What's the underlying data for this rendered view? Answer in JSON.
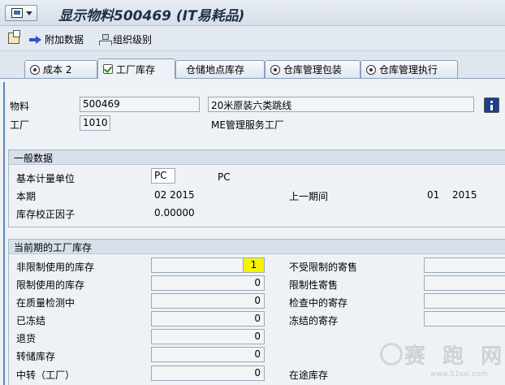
{
  "window": {
    "title": "显示物料500469 (IT易耗品)"
  },
  "toolbar": {
    "additional_data": "附加数据",
    "org_levels": "组织级别"
  },
  "tabs": [
    {
      "label": "成本 2",
      "icon": "radio-icon"
    },
    {
      "label": "工厂库存",
      "icon": "check-icon",
      "active": true
    },
    {
      "label": "仓储地点库存",
      "icon": "none"
    },
    {
      "label": "仓库管理包装",
      "icon": "radio-icon"
    },
    {
      "label": "仓库管理执行",
      "icon": "radio-icon"
    }
  ],
  "header": {
    "material_label": "物料",
    "material_value": "500469",
    "material_desc": "20米原装六类跳线",
    "plant_label": "工厂",
    "plant_value": "1010",
    "plant_desc": "ME管理服务工厂"
  },
  "general": {
    "title": "一般数据",
    "base_uom_label": "基本计量单位",
    "base_uom_value": "PC",
    "base_uom_text": "PC",
    "current_period_label": "本期",
    "current_period_value": "02 2015",
    "prev_period_label": "上一期间",
    "prev_period_month": "01",
    "prev_period_year": "2015",
    "correction_label": "库存校正因子",
    "correction_value": "0.00000"
  },
  "stock": {
    "title": "当前期的工厂库存",
    "rows": [
      {
        "label": "非限制使用的库存",
        "value": "1",
        "right_label": "不受限制的寄售"
      },
      {
        "label": "限制使用的库存",
        "value": "0",
        "right_label": "限制性寄售"
      },
      {
        "label": "在质量检测中",
        "value": "0",
        "right_label": "检查中的寄存"
      },
      {
        "label": "已冻结",
        "value": "0",
        "right_label": "冻结的寄存"
      },
      {
        "label": "退货",
        "value": "0",
        "right_label": ""
      },
      {
        "label": "转储库存",
        "value": "0",
        "right_label": ""
      },
      {
        "label": "中转（工厂）",
        "value": "0",
        "right_label": "在途库存"
      }
    ]
  },
  "watermark": {
    "text": "赛 跑 网",
    "url": "www.51sai.com"
  },
  "colors": {
    "highlight": "#f4f400",
    "accent": "#5c86b7"
  }
}
